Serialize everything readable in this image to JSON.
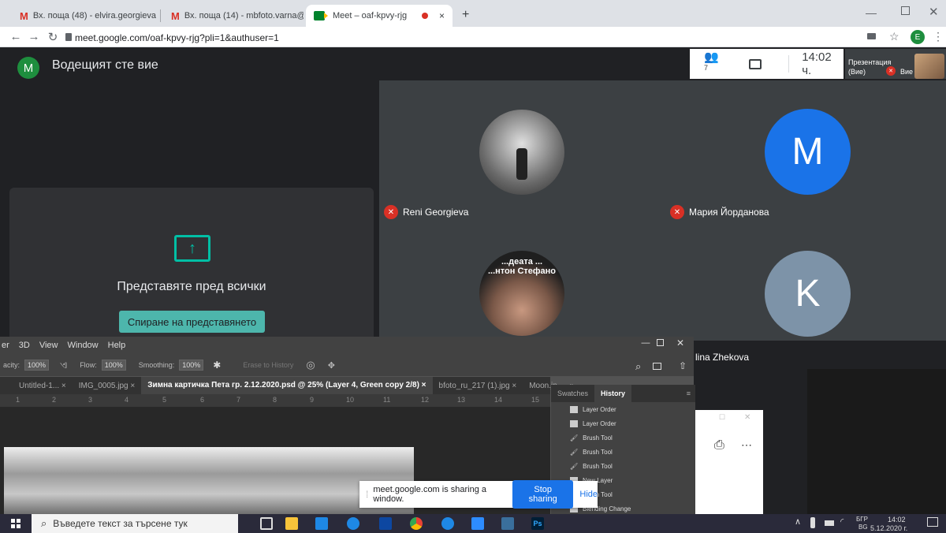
{
  "browser": {
    "tabs": [
      {
        "icon": "M",
        "label": "Вх. поща (48) - elvira.georgieva",
        "close": "×"
      },
      {
        "icon": "M",
        "label": "Вх. поща (14) - mbfoto.varna@",
        "close": "×"
      },
      {
        "icon": "meet-icon",
        "label": "Meet – oaf-kpvy-rjg",
        "close": "×"
      }
    ],
    "new_tab": "+",
    "url": "meet.google.com/oaf-kpvy-rjg?pli=1&authuser=1",
    "profile_initial": "E"
  },
  "meet": {
    "host_initial": "M",
    "host_label": "Водещият сте вие",
    "participants_count": "7",
    "time": "14:02 ч.",
    "presentation_label": "Презентация",
    "presentation_you": "(Вие)",
    "self_label": "Вие",
    "presenting_text": "Представяте пред всички",
    "stop_presenting": "Спиране на представянето",
    "participants": [
      {
        "name": "Reni Georgieva",
        "initial": "",
        "muted": true
      },
      {
        "name": "Мария Йорданова",
        "initial": "M",
        "muted": true,
        "color": "#1a73e8"
      },
      {
        "name": "",
        "initial": "",
        "overlay_line1": "...деата ...",
        "overlay_line2": "...нтон Стефано"
      },
      {
        "name": "lina Zhekova",
        "initial": "K",
        "color": "#7d93a8"
      }
    ]
  },
  "photoshop": {
    "menu": [
      "er",
      "3D",
      "View",
      "Window",
      "Help"
    ],
    "options": {
      "opacity_label": "acity:",
      "opacity_value": "100%",
      "flow_label": "Flow:",
      "flow_value": "100%",
      "smoothing_label": "Smoothing:",
      "smoothing_value": "100%",
      "erase_history": "Erase to History"
    },
    "doc_tabs": [
      {
        "label": "Untitled-1... ×",
        "active": false
      },
      {
        "label": "IMG_0005.jpg ×",
        "active": false
      },
      {
        "label": "Зимна картичка Пета гр. 2.12.2020.psd @ 25% (Layer 4, Green copy 2/8) ×",
        "active": true
      },
      {
        "label": "bfoto_ru_217 (1).jpg ×",
        "active": false
      },
      {
        "label": "Moon.jp",
        "active": false
      }
    ],
    "ruler": [
      "1",
      "2",
      "3",
      "4",
      "5",
      "6",
      "7",
      "8",
      "9",
      "10",
      "11",
      "12",
      "13",
      "14",
      "15"
    ],
    "panel_tabs": [
      "Swatches",
      "History"
    ],
    "history": [
      "Layer Order",
      "Layer Order",
      "Brush Tool",
      "Brush Tool",
      "Brush Tool",
      "New Layer",
      "Brush Tool",
      "Blending Change"
    ]
  },
  "share_bar": {
    "text": "meet.google.com is sharing a window.",
    "stop": "Stop sharing",
    "hide": "Hide"
  },
  "taskbar": {
    "search_placeholder": "Въведете текст за търсене тук",
    "lang": "БГР",
    "lang2": "BG",
    "time": "14:02",
    "date": "5.12.2020 г."
  }
}
